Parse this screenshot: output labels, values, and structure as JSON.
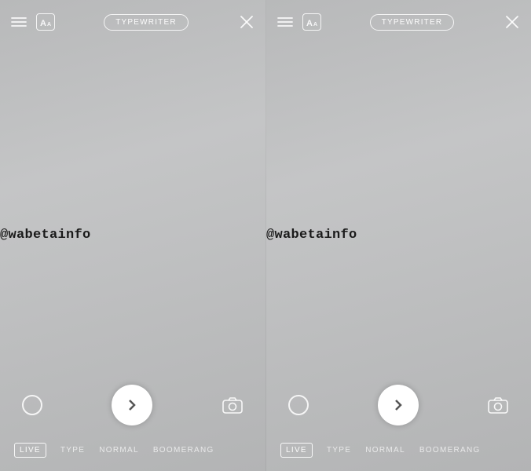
{
  "panels": [
    {
      "header": {
        "style_label": "TYPEWRITER"
      },
      "watermark": "@wabetainfo",
      "modes": {
        "live": "LIVE",
        "type": "TYPE",
        "normal": "NORMAL",
        "boomerang": "BOOMERANG"
      }
    },
    {
      "header": {
        "style_label": "TYPEWRITER"
      },
      "watermark": "@wabetainfo",
      "modes": {
        "live": "LIVE",
        "type": "TYPE",
        "normal": "NORMAL",
        "boomerang": "BOOMERANG"
      }
    }
  ]
}
